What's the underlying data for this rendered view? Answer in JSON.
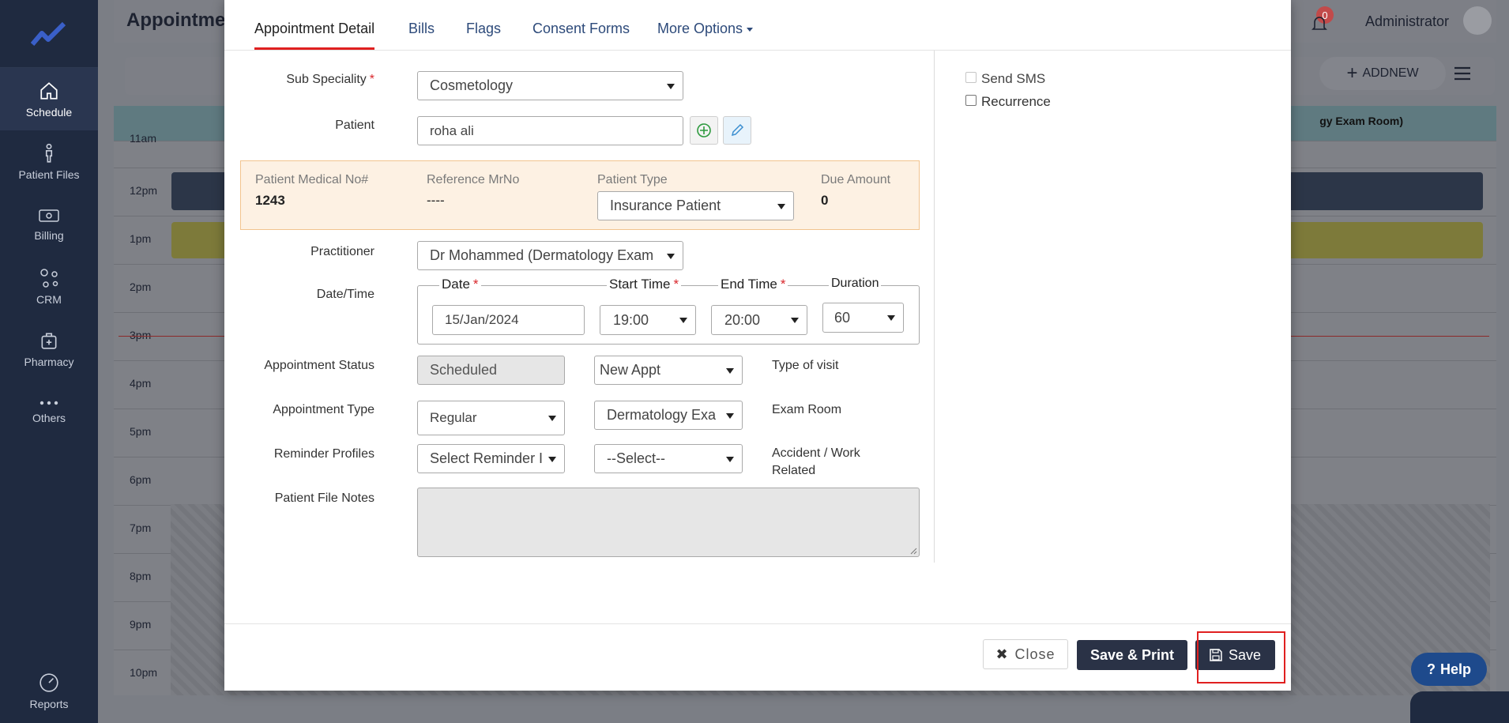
{
  "sidebar": {
    "items": [
      {
        "label": "Schedule",
        "icon": "home-icon"
      },
      {
        "label": "Patient Files",
        "icon": "person-icon"
      },
      {
        "label": "Billing",
        "icon": "banknote-icon"
      },
      {
        "label": "CRM",
        "icon": "network-icon"
      },
      {
        "label": "Pharmacy",
        "icon": "medical-kit-icon"
      },
      {
        "label": "Others",
        "icon": "ellipsis-icon"
      }
    ],
    "reports_label": "Reports"
  },
  "background": {
    "page_title": "Appointme",
    "user_name": "Administrator",
    "notification_count": "0",
    "add_new_label": "ADDNEW",
    "room_header": "gy Exam Room)",
    "times": [
      "11am",
      "12pm",
      "1pm",
      "2pm",
      "3pm",
      "4pm",
      "5pm",
      "6pm",
      "7pm",
      "8pm",
      "9pm",
      "10pm"
    ],
    "help_label": "Help"
  },
  "modal": {
    "tabs": [
      "Appointment Detail",
      "Bills",
      "Flags",
      "Consent Forms",
      "More Options"
    ],
    "sub_speciality": {
      "label": "Sub Speciality",
      "value": "Cosmetology"
    },
    "patient": {
      "label": "Patient",
      "value": "roha ali"
    },
    "info": {
      "medical_no_label": "Patient Medical No#",
      "medical_no_value": "1243",
      "ref_mrno_label": "Reference MrNo",
      "ref_mrno_value": "----",
      "patient_type_label": "Patient Type",
      "patient_type_value": "Insurance Patient",
      "due_amount_label": "Due Amount",
      "due_amount_value": "0"
    },
    "practitioner": {
      "label": "Practitioner",
      "value": "Dr Mohammed (Dermatology Exam"
    },
    "datetime": {
      "label": "Date/Time",
      "date_label": "Date",
      "date_value": "15/Jan/2024",
      "start_label": "Start Time",
      "start_value": "19:00",
      "end_label": "End Time",
      "end_value": "20:00",
      "duration_label": "Duration",
      "duration_value": "60"
    },
    "status": {
      "label": "Appointment Status",
      "value": "Scheduled",
      "visit_value": "New Appt",
      "visit_label": "Type of visit"
    },
    "appt_type": {
      "label": "Appointment Type",
      "value": "Regular",
      "room_value": "Dermatology Exa",
      "room_label": "Exam Room"
    },
    "reminder": {
      "label": "Reminder Profiles",
      "value": "Select Reminder I",
      "accident_value": "--Select--",
      "accident_label": "Accident / Work Related"
    },
    "notes": {
      "label": "Patient File Notes"
    },
    "send_sms_label": "Send SMS",
    "recurrence_label": "Recurrence",
    "close_label": "Close",
    "save_print_label": "Save & Print",
    "save_label": "Save"
  }
}
